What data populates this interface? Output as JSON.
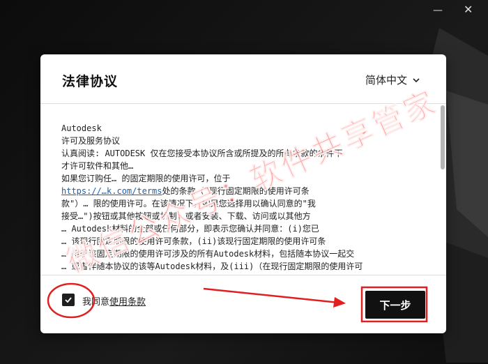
{
  "window": {
    "minimize_glyph": "—",
    "close_glyph": "✕"
  },
  "dialog": {
    "title": "法律协议",
    "language": "简体中文"
  },
  "license": {
    "lines": [
      "Autodesk",
      "许可及服务协议",
      "认真阅读: AUTODESK 仅在您接受本协议所含或所提及的所有条款的条件下",
      "才许可软件和其他…",
      "如果您订购任… 的固定期限的使用许可，位于",
      "处的条款（\"现行固定期限的使用许可条",
      "款\"）… 限的使用许可。在该情况下，如果您选择用以确认同意的\"我",
      "接受…\")按钮或其他按钮或机制，或者安装、下载、访问或以其他方",
      "… Autodesk材料的全部或任何部分，即表示您确认并同意：(i)您已",
      "… 该现行固定期限的使用许可条款，(ii)该现行固定期限的使用许可条",
      "… 用于该固定期限的使用许可涉及的所有Autodesk材料，包括随本协议一起交",
      "… 或者伴随本协议的该等Autodesk材料，及(iii)（在现行固定期限的使用许可"
    ],
    "link_text": "https://…k.com/terms"
  },
  "agree": {
    "prefix": "我同意",
    "link": "使用条款",
    "checked": true
  },
  "next_button": "下一步",
  "watermark": "微信公众号：软件共享管家",
  "colors": {
    "accent": "#111111",
    "link": "#1a5fb4",
    "annotation": "#e02020",
    "watermark": "#ff4646"
  }
}
